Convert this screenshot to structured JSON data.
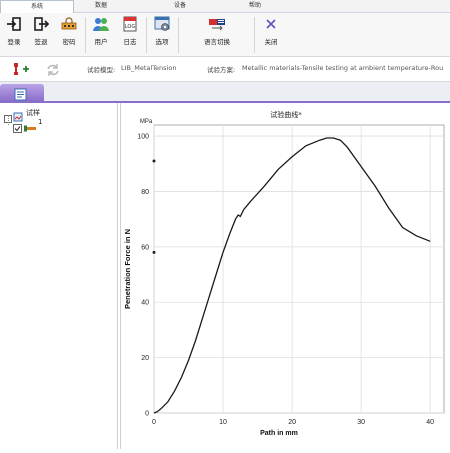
{
  "menu": {
    "tabs": [
      {
        "label": "系统",
        "active": true
      },
      {
        "label": "数据",
        "active": false
      },
      {
        "label": "设备",
        "active": false
      },
      {
        "label": "帮助",
        "active": false
      }
    ]
  },
  "ribbon": {
    "buttons": [
      {
        "label": "登录",
        "icon": "login-icon"
      },
      {
        "label": "签退",
        "icon": "logout-icon"
      },
      {
        "label": "密码",
        "icon": "password-icon"
      },
      {
        "label": "用户",
        "icon": "users-icon"
      },
      {
        "label": "日志",
        "icon": "log-icon"
      },
      {
        "label": "选项",
        "icon": "options-icon"
      },
      {
        "label": "语言切换",
        "icon": "language-switch-icon"
      },
      {
        "label": "关闭",
        "icon": "close-icon"
      }
    ]
  },
  "infobar": {
    "template_label": "试验模型:",
    "template_value": "LIB_MetalTension",
    "scheme_label": "试验方案:",
    "scheme_value": "Metallic materials-Tensile testing at ambient temperature-Rou"
  },
  "tree": {
    "root_label": "试样",
    "child_label": "1"
  },
  "chart_data": {
    "type": "line",
    "title": "试验曲线*",
    "xlabel": "Path in mm",
    "ylabel": "Penetration Force in N",
    "ylabel_unit": "MPa",
    "xlim": [
      0,
      42
    ],
    "ylim": [
      0,
      104
    ],
    "xticks": [
      0,
      10,
      20,
      30,
      40
    ],
    "yticks": [
      0,
      20,
      40,
      60,
      80,
      100
    ],
    "grid": true,
    "series": [
      {
        "color": "#1a1a1a",
        "x": [
          0,
          0.5,
          1,
          2,
          3,
          4,
          5,
          6,
          7,
          8,
          9,
          10,
          11,
          11.8,
          12.2,
          12.5,
          13,
          14,
          16,
          18,
          20,
          22,
          24,
          25,
          26,
          27,
          28,
          30,
          32,
          34,
          36,
          38,
          40
        ],
        "y": [
          0,
          0.5,
          1.5,
          4,
          8,
          13,
          19,
          26,
          34,
          42,
          50,
          58,
          65,
          70,
          71.5,
          71,
          73.5,
          76.5,
          82,
          88,
          92.5,
          96.5,
          98.5,
          99.3,
          99.3,
          98.5,
          96,
          89,
          82,
          74,
          67,
          64,
          62
        ]
      }
    ],
    "markers": [
      {
        "x": 0,
        "y": 91
      },
      {
        "x": 0,
        "y": 58
      }
    ]
  }
}
